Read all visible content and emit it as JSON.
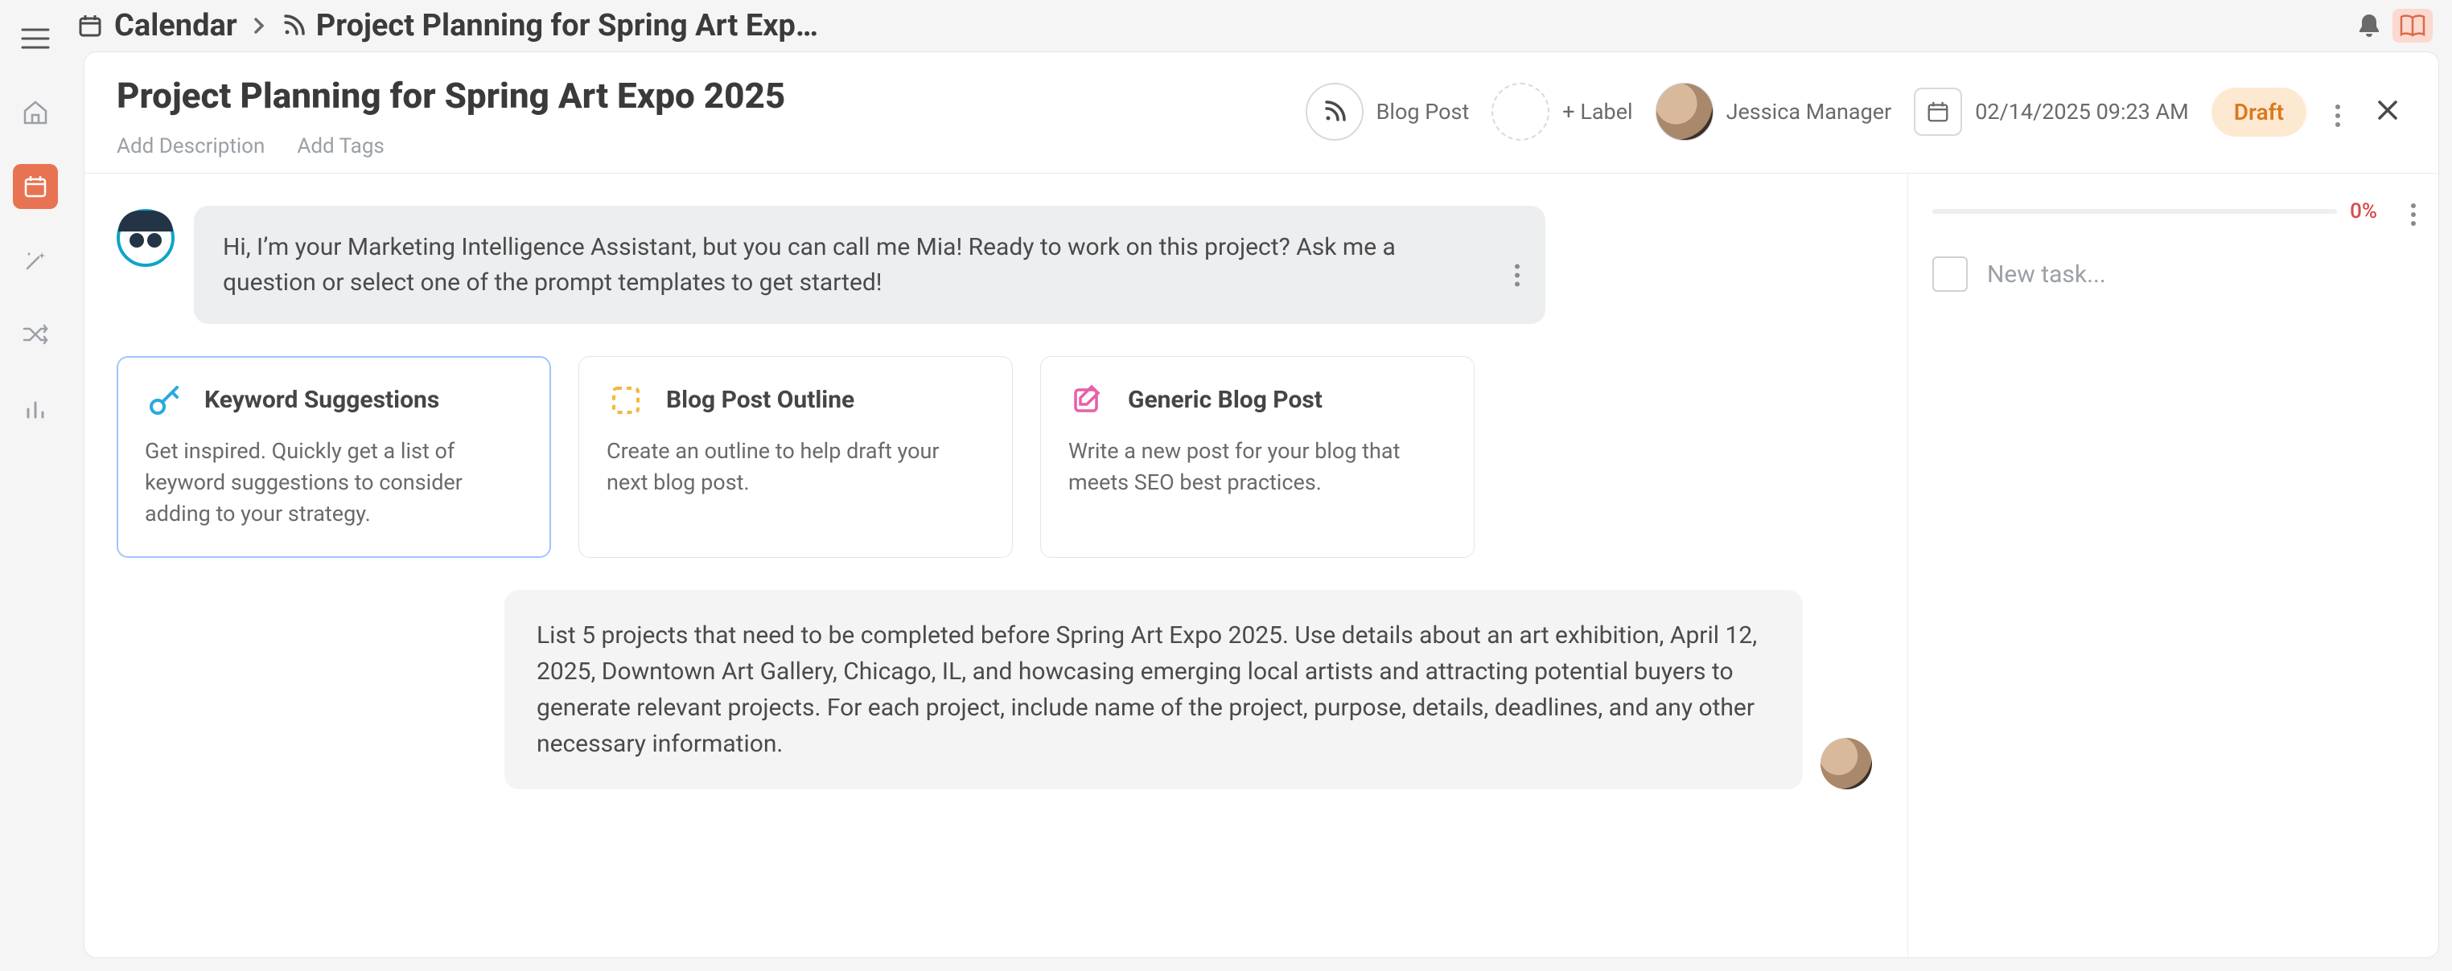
{
  "breadcrumb": {
    "root_label": "Calendar",
    "item_label": "Project Planning for Spring Art Exp…"
  },
  "header": {
    "title": "Project Planning for Spring Art Expo 2025",
    "add_description": "Add Description",
    "add_tags": "Add Tags",
    "type_label": "Blog Post",
    "add_label": "+ Label",
    "owner": "Jessica Manager",
    "date": "02/14/2025 09:23 AM",
    "status": "Draft"
  },
  "mia": {
    "greeting": "Hi, I’m your Marketing Intelligence Assistant, but you can call me Mia! Ready to work on this project? Ask me a question or select one of the prompt templates to get started!"
  },
  "prompts": [
    {
      "title": "Keyword Suggestions",
      "desc": "Get inspired. Quickly get a list of keyword suggestions to consider adding to your strategy."
    },
    {
      "title": "Blog Post Outline",
      "desc": "Create an outline to help draft your next blog post."
    },
    {
      "title": "Generic Blog Post",
      "desc": "Write a new post for your blog that meets SEO best practices."
    }
  ],
  "user_message": "List 5 projects that need to be completed before Spring Art Expo 2025. Use details about an art exhibition, April 12, 2025, Downtown Art Gallery, Chicago, IL, and howcasing emerging local artists and attracting potential buyers to generate relevant projects. For each project, include name of the project, purpose, details, deadlines, and any other necessary information.",
  "side": {
    "progress_pct": "0%",
    "new_task_placeholder": "New task..."
  }
}
